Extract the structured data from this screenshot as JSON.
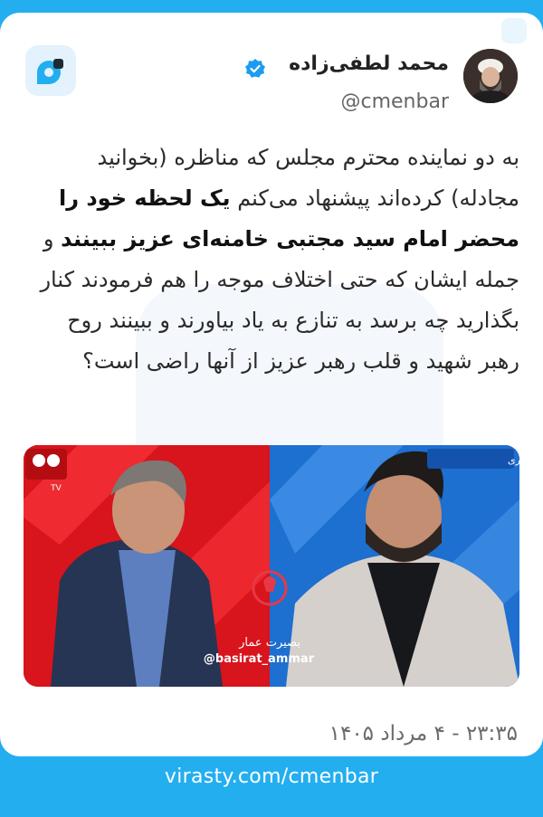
{
  "author": {
    "name": "محمد لطفی‌زاده",
    "handle": "@cmenbar",
    "verified": true,
    "avatar_icon": "person-avatar"
  },
  "app": {
    "logo_icon": "virasty-logo",
    "brand_color": "#23aef0"
  },
  "post": {
    "segments": [
      {
        "text": "به دو نماینده محترم مجلس که مناظره (بخوانید مجادله) کرده‌اند پیشنهاد می‌کنم ",
        "bold": false
      },
      {
        "text": "یک لحظه خود را محضر امام سید مجتبی خامنه‌ای عزیز ببینند",
        "bold": true
      },
      {
        "text": " و جمله ایشان که حتی اختلاف موجه را هم فرمودند کنار بگذارید چه برسد به تنازع به یاد بیاورند و ببینند روح رهبر شهید و قلب رهبر عزیز از آنها راضی است؟",
        "bold": false
      }
    ],
    "timestamp": "۲۳:۳۵ - ۴ مرداد ۱۴۰۵"
  },
  "video": {
    "left_channel_tag": "TV",
    "right_channel_tag": "استودیو همشهری",
    "watermark_name": "بصیرت عمار",
    "watermark_handle": "@basirat_ammar"
  },
  "footer": {
    "link": "virasty.com/cmenbar"
  }
}
